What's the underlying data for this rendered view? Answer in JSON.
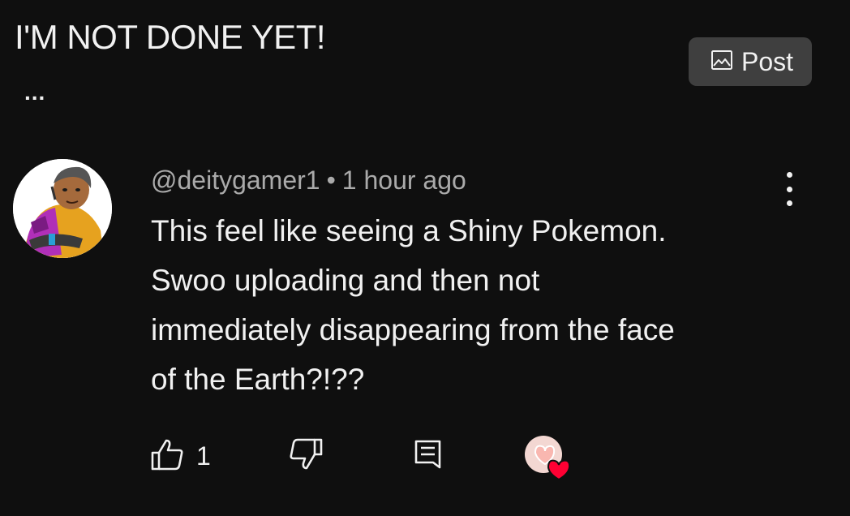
{
  "header": {
    "title": "I'M NOT DONE YET!",
    "more_text": "...",
    "post_button": {
      "label": "Post",
      "icon": "image-icon"
    }
  },
  "comment": {
    "author": "@deitygamer1",
    "separator": "•",
    "timestamp": "1 hour ago",
    "text_lines": [
      "This feel like seeing a Shiny Pokemon.",
      "Swoo uploading and then not",
      "immediately disappearing from the face",
      "of the Earth?!??"
    ],
    "like_count": "1",
    "icons": {
      "menu": "vertical-ellipsis-icon",
      "like": "thumbs-up-icon",
      "dislike": "thumbs-down-icon",
      "reply": "reply-icon",
      "creator_heart": "creator-heart-icon"
    }
  },
  "colors": {
    "background": "#0f0f0f",
    "text": "#f1f1f1",
    "secondary_text": "#aaaaaa",
    "button_bg": "#3f3f3f",
    "heart": "#ff0033"
  }
}
